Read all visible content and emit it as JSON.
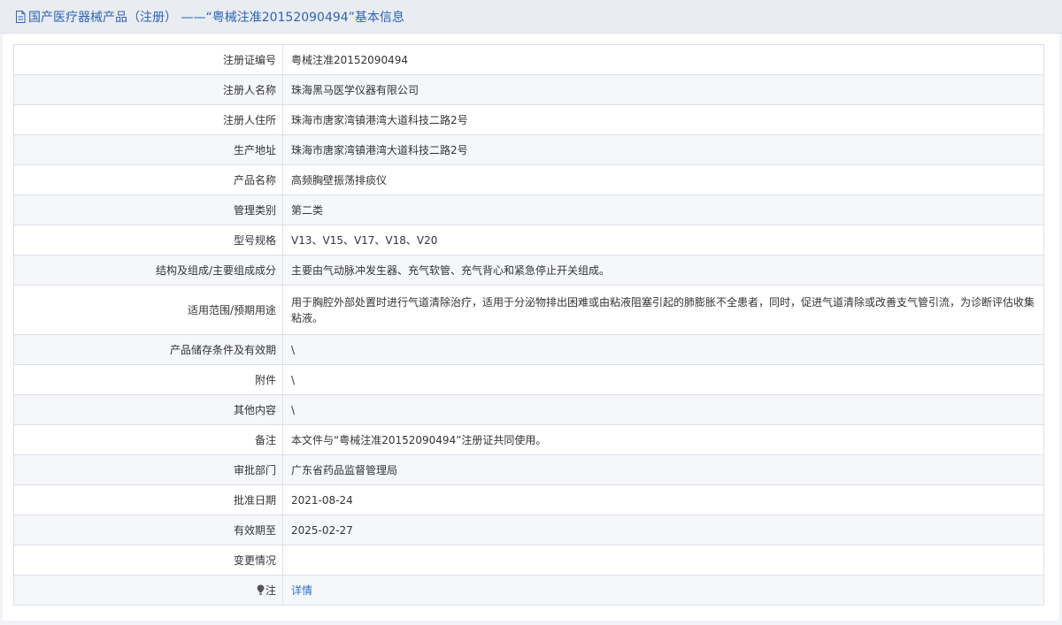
{
  "page": {
    "title": "国产医疗器械产品（注册） ——“粤械注准20152090494”基本信息"
  },
  "colors": {
    "title_text": "#2c65b6",
    "link": "#2c6fc6",
    "row_alt": "#f5f7fa",
    "border": "#dcdfe6"
  },
  "icons": {
    "title": "document-icon",
    "note": "lightbulb-icon"
  },
  "rows": [
    {
      "label": "注册证编号",
      "value": "粤械注准20152090494"
    },
    {
      "label": "注册人名称",
      "value": "珠海黑马医学仪器有限公司"
    },
    {
      "label": "注册人住所",
      "value": "珠海市唐家湾镇港湾大道科技二路2号"
    },
    {
      "label": "生产地址",
      "value": "珠海市唐家湾镇港湾大道科技二路2号"
    },
    {
      "label": "产品名称",
      "value": "高频胸壁振荡排痰仪"
    },
    {
      "label": "管理类别",
      "value": "第二类"
    },
    {
      "label": "型号规格",
      "value": "V13、V15、V17、V18、V20"
    },
    {
      "label": "结构及组成/主要组成成分",
      "value": "主要由气动脉冲发生器、充气软管、充气背心和紧急停止开关组成。"
    },
    {
      "label": "适用范围/预期用途",
      "value": "用于胸腔外部处置时进行气道清除治疗，适用于分泌物排出困难或由粘液阻塞引起的肺膨胀不全患者，同时，促进气道清除或改善支气管引流，为诊断评估收集粘液。"
    },
    {
      "label": "产品储存条件及有效期",
      "value": "\\"
    },
    {
      "label": "附件",
      "value": "\\"
    },
    {
      "label": "其他内容",
      "value": "\\"
    },
    {
      "label": "备注",
      "value": "本文件与“粤械注准20152090494”注册证共同使用。"
    },
    {
      "label": "审批部门",
      "value": "广东省药品监督管理局"
    },
    {
      "label": "批准日期",
      "value": "2021-08-24"
    },
    {
      "label": "有效期至",
      "value": "2025-02-27"
    },
    {
      "label": "变更情况",
      "value": ""
    },
    {
      "label": "注",
      "value": "详情"
    }
  ]
}
